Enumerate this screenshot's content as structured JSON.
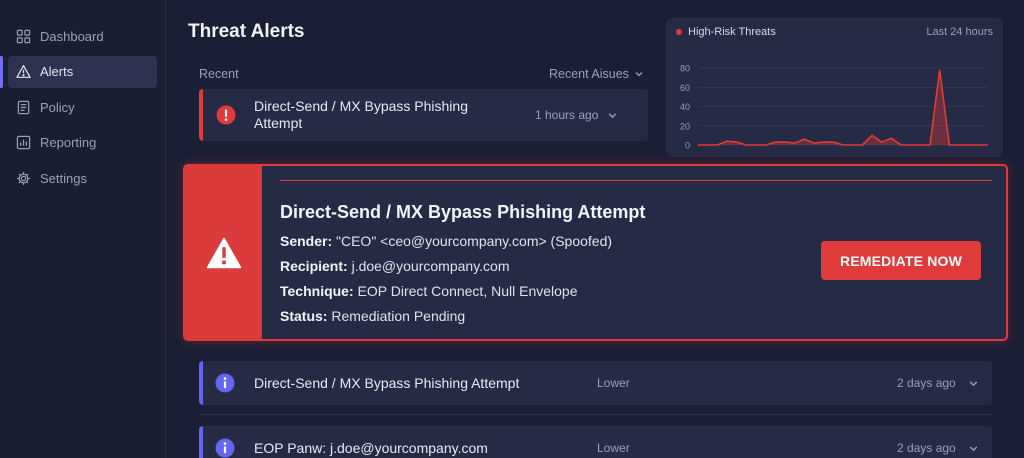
{
  "sidebar": {
    "items": [
      {
        "label": "Dashboard",
        "icon": "dashboard-icon"
      },
      {
        "label": "Alerts",
        "icon": "alert-triangle-icon",
        "active": true
      },
      {
        "label": "Policy",
        "icon": "document-icon"
      },
      {
        "label": "Reporting",
        "icon": "bar-chart-icon"
      },
      {
        "label": "Settings",
        "icon": "gear-icon"
      }
    ]
  },
  "header": {
    "title": "Threat Alerts",
    "recent_label": "Recent",
    "recent_select": "Recent Aisues"
  },
  "recent_alert": {
    "title": "Direct-Send / MX Bypass Phishing Attempt",
    "time": "1 hours ago"
  },
  "chart": {
    "legend": "High-Risk Threats",
    "range": "Last 24 hours"
  },
  "chart_data": {
    "type": "area",
    "series": [
      {
        "name": "High-Risk Threats",
        "values": [
          0,
          0,
          0,
          4,
          3,
          0,
          0,
          0,
          3,
          3,
          2,
          6,
          2,
          3,
          3,
          0,
          0,
          0,
          10,
          3,
          7,
          0,
          0,
          0,
          0,
          78,
          0,
          0,
          0,
          0,
          0
        ]
      }
    ],
    "ylim": [
      0,
      80
    ],
    "yticks": [
      "0",
      "20",
      "40",
      "60",
      "80"
    ],
    "color": "#e53935",
    "grid": true,
    "legend_position": "top-left"
  },
  "featured_alert": {
    "title": "Direct-Send / MX Bypass Phishing Attempt",
    "sender_label": "Sender:",
    "sender_value": "\"CEO\" <ceo@yourcompany.com> (Spoofed)",
    "recipient_label": "Recipient:",
    "recipient_value": "j.doe@yourcompany.com",
    "technique_label": "Technique:",
    "technique_value": "EOP Direct Connect, Null Envelope",
    "status_label": "Status:",
    "status_value": "Remediation Pending",
    "action": "REMEDIATE NOW"
  },
  "alerts": [
    {
      "title": "Direct-Send / MX Bypass Phishing Attempt",
      "severity": "Lower",
      "time": "2 days ago"
    },
    {
      "title": "EOP Panw: j.doe@yourcompany.com",
      "severity": "Lower",
      "time": "2 days ago"
    }
  ],
  "colors": {
    "accent_red": "#e03a3a",
    "accent_blue": "#6366f1",
    "background": "#1b1f35",
    "card": "#262b45"
  }
}
